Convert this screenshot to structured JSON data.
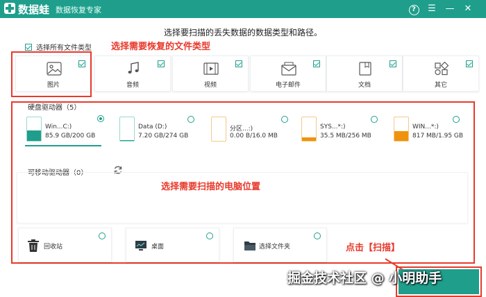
{
  "titlebar": {
    "app_name": "数据蛙",
    "subtitle": "数据恢复专家",
    "help_icon": "help-icon",
    "menu_icon": "menu-icon",
    "minimize_icon": "minimize-icon",
    "close_icon": "close-icon",
    "bg_color": "#1f9e8c"
  },
  "prompt": "选择要扫描的丢失数据的数据类型和路径。",
  "select_all": {
    "label": "选择所有文件类型",
    "checked": true
  },
  "annotations": {
    "file_type": "选择需要恢复的文件类型",
    "location": "选择需要扫描的电脑位置",
    "scan": "点击【扫描】"
  },
  "file_types": [
    {
      "label": "图片",
      "icon": "image-icon",
      "checked": true
    },
    {
      "label": "音频",
      "icon": "music-icon",
      "checked": true
    },
    {
      "label": "视频",
      "icon": "video-icon",
      "checked": true
    },
    {
      "label": "电子邮件",
      "icon": "email-icon",
      "checked": true
    },
    {
      "label": "文档",
      "icon": "document-icon",
      "checked": true
    },
    {
      "label": "其它",
      "icon": "other-icon",
      "checked": true
    }
  ],
  "hard_drives": {
    "title": "硬盘驱动器（5）",
    "items": [
      {
        "name": "Win...C:)",
        "size": "85.9 GB/200 GB",
        "used_fraction": 0.43,
        "color": "teal",
        "selected": true
      },
      {
        "name": "Data (D:)",
        "size": "7.20 GB/274 GB",
        "used_fraction": 0.03,
        "color": "teal",
        "selected": false
      },
      {
        "name": "分区...:)",
        "size": "0.00  B/16.0 MB",
        "used_fraction": 0.0,
        "color": "orange",
        "selected": false
      },
      {
        "name": "SYS...*:)",
        "size": "35.5 MB/256 MB",
        "used_fraction": 0.14,
        "color": "orange",
        "selected": false
      },
      {
        "name": "WIN...*:)",
        "size": "817 MB/1.95 GB",
        "used_fraction": 0.42,
        "color": "orange",
        "selected": false
      }
    ]
  },
  "removable": {
    "title": "可移动驱动器（0）",
    "refresh_icon": "refresh-icon"
  },
  "locations": [
    {
      "label": "回收站",
      "icon": "recycle-bin-icon",
      "selected": false
    },
    {
      "label": "桌面",
      "icon": "desktop-icon",
      "selected": false
    },
    {
      "label": "选择文件夹",
      "icon": "folder-icon",
      "selected": false
    }
  ],
  "watermark": "掘金技术社区 @ 小明助手",
  "colors": {
    "accent": "#1f9e8c",
    "annotation": "#e8392b",
    "warning": "#f0920e"
  }
}
